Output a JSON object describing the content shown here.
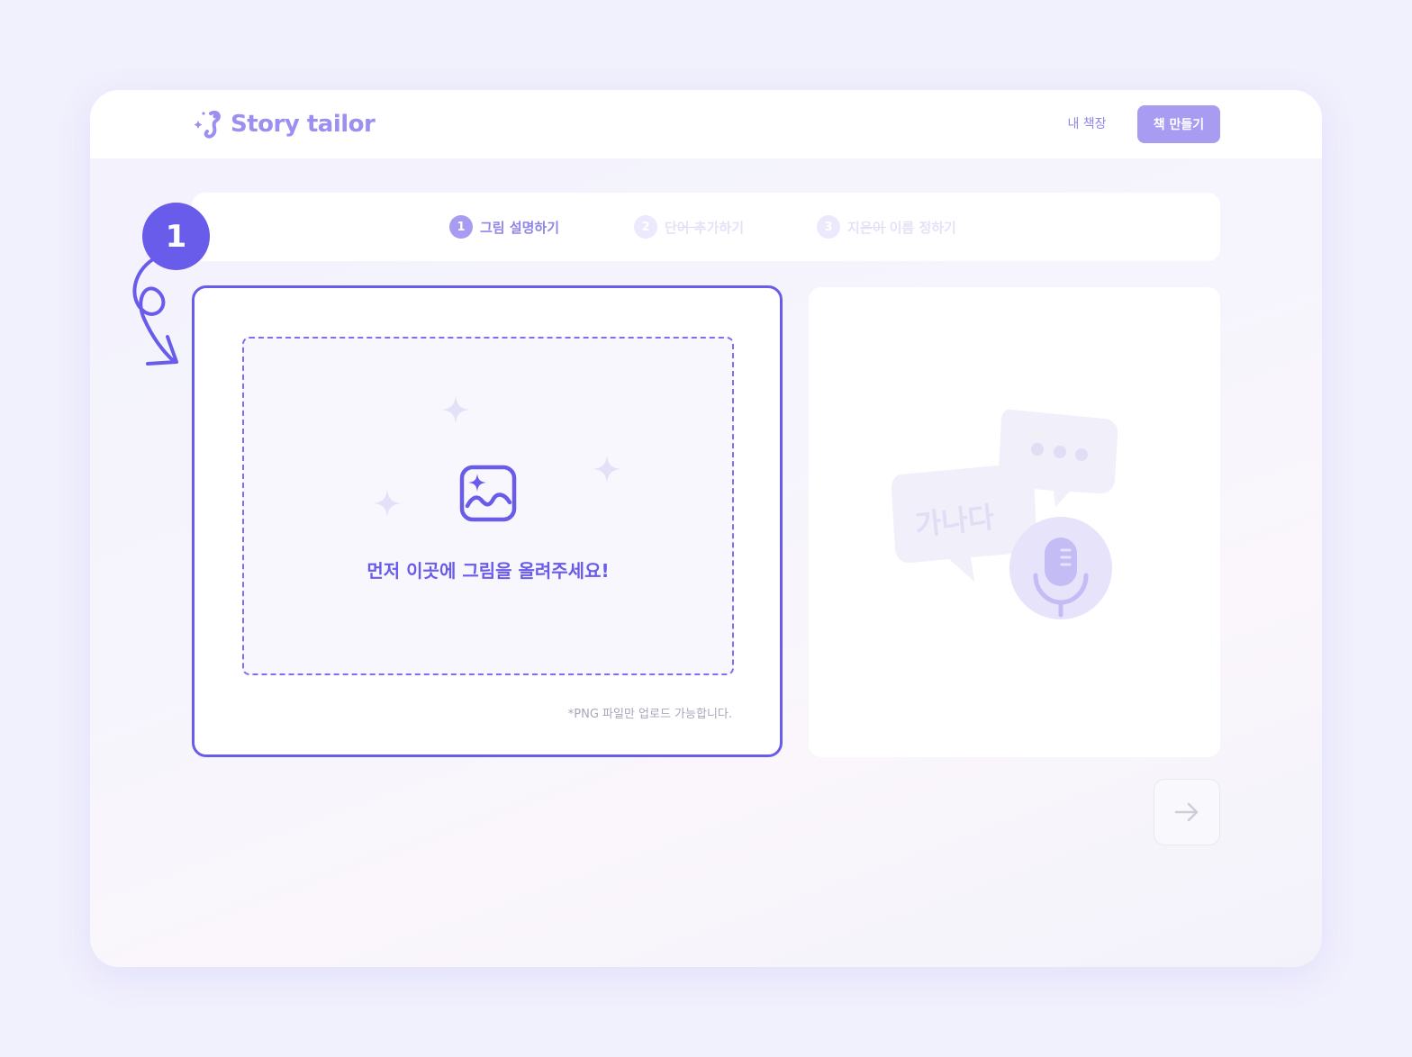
{
  "header": {
    "brand": "Story tailor",
    "nav_bookshelf": "내 책장",
    "make_book_button": "책 만들기"
  },
  "stepper": {
    "steps": [
      {
        "number": "1",
        "label": "그림 설명하기",
        "state": "active"
      },
      {
        "number": "2",
        "label": "단어 추가하기",
        "state": "inactive"
      },
      {
        "number": "3",
        "label": "지은이 이름 정하기",
        "state": "inactive"
      }
    ]
  },
  "upload": {
    "prompt": "먼저 이곳에 그림을 올려주세요!",
    "note": "*PNG 파일만 업로드 가능합니다."
  },
  "preview": {
    "illustration_text": "가나다",
    "icons": [
      "speech-bubble-icon",
      "chat-bubble-icon",
      "microphone-icon"
    ]
  },
  "annotation": {
    "badge_number": "1"
  },
  "colors": {
    "accent": "#6a5cea",
    "accent_light": "#a79cf2",
    "background": "#f1f0fd"
  }
}
